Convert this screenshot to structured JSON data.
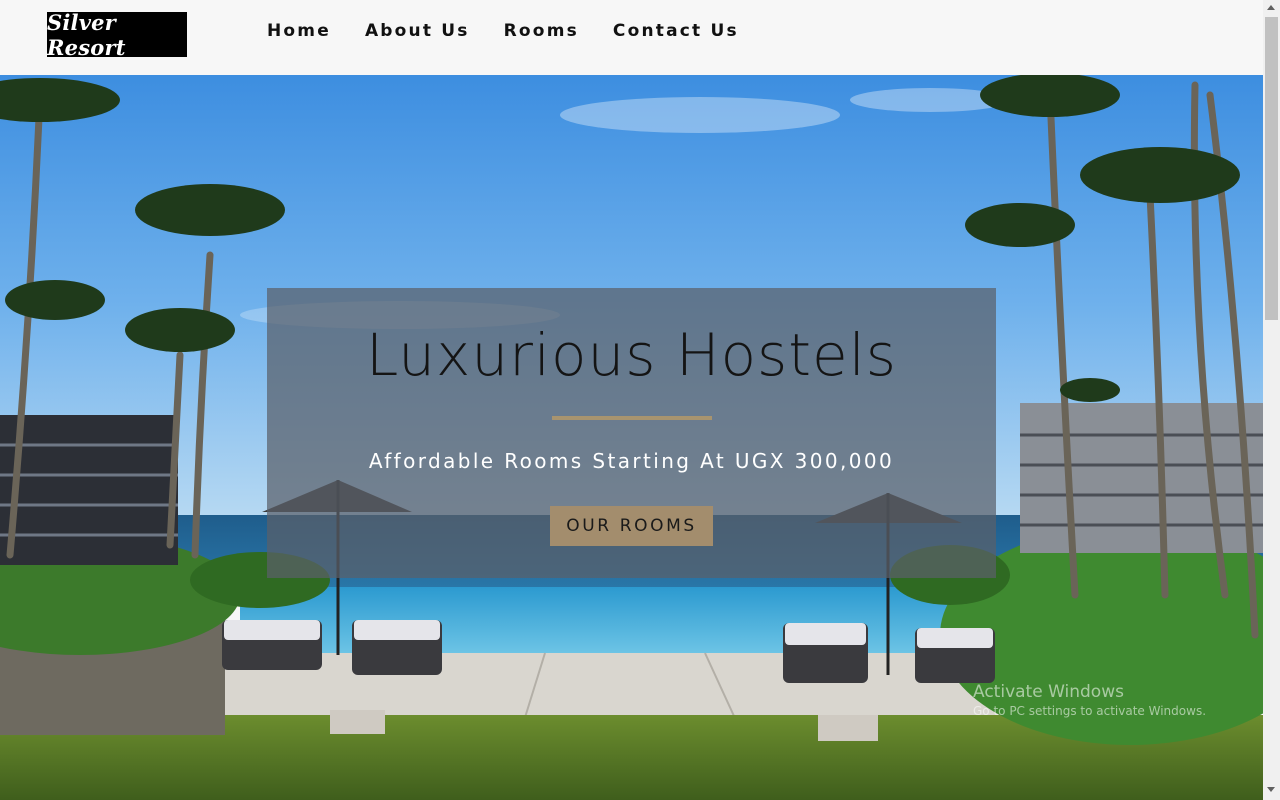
{
  "header": {
    "logo_text": "Silver Resort",
    "nav": [
      {
        "label": "Home"
      },
      {
        "label": "About Us"
      },
      {
        "label": "Rooms"
      },
      {
        "label": "Contact Us"
      }
    ]
  },
  "hero": {
    "title": "Luxurious Hostels",
    "subtitle": "Affordable Rooms Starting At UGX 300,000",
    "button_label": "OUR ROOMS"
  },
  "watermark": {
    "line1": "Activate Windows",
    "line2": "Go to PC settings to activate Windows."
  },
  "colors": {
    "accent": "#a38d6d",
    "overlay": "rgba(90,95,105,0.72)",
    "header_bg": "#f7f7f7"
  }
}
